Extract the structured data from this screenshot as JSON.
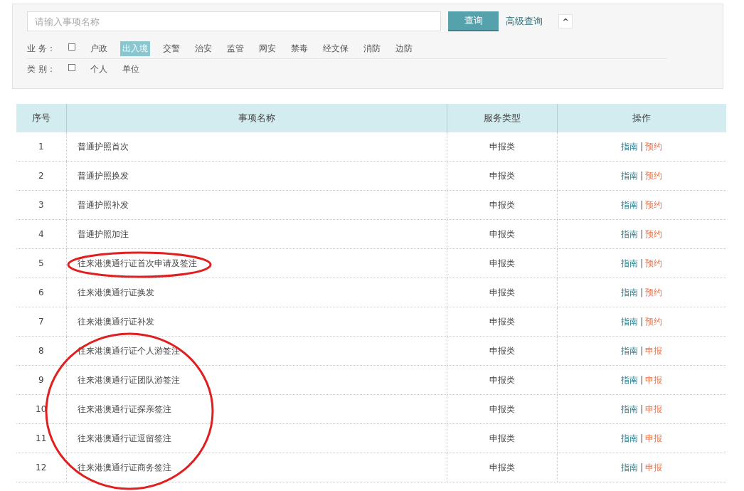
{
  "search": {
    "placeholder": "请输入事项名称",
    "button": "查询",
    "advanced_link": "高级查询",
    "collapse_button": "^"
  },
  "filters": [
    {
      "label": "业 务：",
      "checked": false,
      "options": [
        {
          "label": "户政",
          "selected": false
        },
        {
          "label": "出入境",
          "selected": true
        },
        {
          "label": "交警",
          "selected": false
        },
        {
          "label": "治安",
          "selected": false
        },
        {
          "label": "监管",
          "selected": false
        },
        {
          "label": "网安",
          "selected": false
        },
        {
          "label": "禁毒",
          "selected": false
        },
        {
          "label": "经文保",
          "selected": false
        },
        {
          "label": "消防",
          "selected": false
        },
        {
          "label": "边防",
          "selected": false
        }
      ]
    },
    {
      "label": "类 别：",
      "checked": false,
      "options": [
        {
          "label": "个人",
          "selected": false
        },
        {
          "label": "单位",
          "selected": false
        }
      ]
    }
  ],
  "table": {
    "columns": [
      "序号",
      "事项名称",
      "服务类型",
      "操作"
    ],
    "rows": [
      {
        "no": "1",
        "name": "普通护照首次",
        "type": "申报类",
        "actions": [
          {
            "label": "指南",
            "kind": "guide"
          },
          {
            "label": "预约",
            "kind": "book"
          }
        ],
        "separator": "|"
      },
      {
        "no": "2",
        "name": "普通护照换发",
        "type": "申报类",
        "actions": [
          {
            "label": "指南",
            "kind": "guide"
          },
          {
            "label": "预约",
            "kind": "book"
          }
        ],
        "separator": "|"
      },
      {
        "no": "3",
        "name": "普通护照补发",
        "type": "申报类",
        "actions": [
          {
            "label": "指南",
            "kind": "guide"
          },
          {
            "label": "预约",
            "kind": "book"
          }
        ],
        "separator": "|"
      },
      {
        "no": "4",
        "name": "普通护照加注",
        "type": "申报类",
        "actions": [
          {
            "label": "指南",
            "kind": "guide"
          },
          {
            "label": "预约",
            "kind": "book"
          }
        ],
        "separator": "|"
      },
      {
        "no": "5",
        "name": "往来港澳通行证首次申请及签注",
        "type": "申报类",
        "actions": [
          {
            "label": "指南",
            "kind": "guide"
          },
          {
            "label": "预约",
            "kind": "book"
          }
        ],
        "separator": "|"
      },
      {
        "no": "6",
        "name": "往来港澳通行证换发",
        "type": "申报类",
        "actions": [
          {
            "label": "指南",
            "kind": "guide"
          },
          {
            "label": "预约",
            "kind": "book"
          }
        ],
        "separator": "|"
      },
      {
        "no": "7",
        "name": "往来港澳通行证补发",
        "type": "申报类",
        "actions": [
          {
            "label": "指南",
            "kind": "guide"
          },
          {
            "label": "预约",
            "kind": "book"
          }
        ],
        "separator": "|"
      },
      {
        "no": "8",
        "name": "往来港澳通行证个人游签注",
        "type": "申报类",
        "actions": [
          {
            "label": "指南",
            "kind": "guide"
          },
          {
            "label": "申报",
            "kind": "apply"
          }
        ],
        "separator": "|"
      },
      {
        "no": "9",
        "name": "往来港澳通行证团队游签注",
        "type": "申报类",
        "actions": [
          {
            "label": "指南",
            "kind": "guide"
          },
          {
            "label": "申报",
            "kind": "apply"
          }
        ],
        "separator": "|"
      },
      {
        "no": "10",
        "name": "往来港澳通行证探亲签注",
        "type": "申报类",
        "actions": [
          {
            "label": "指南",
            "kind": "guide"
          },
          {
            "label": "申报",
            "kind": "apply"
          }
        ],
        "separator": "|"
      },
      {
        "no": "11",
        "name": "往来港澳通行证逗留签注",
        "type": "申报类",
        "actions": [
          {
            "label": "指南",
            "kind": "guide"
          },
          {
            "label": "申报",
            "kind": "apply"
          }
        ],
        "separator": "|"
      },
      {
        "no": "12",
        "name": "往来港澳通行证商务签注",
        "type": "申报类",
        "actions": [
          {
            "label": "指南",
            "kind": "guide"
          },
          {
            "label": "申报",
            "kind": "apply"
          }
        ],
        "separator": "|"
      }
    ]
  }
}
